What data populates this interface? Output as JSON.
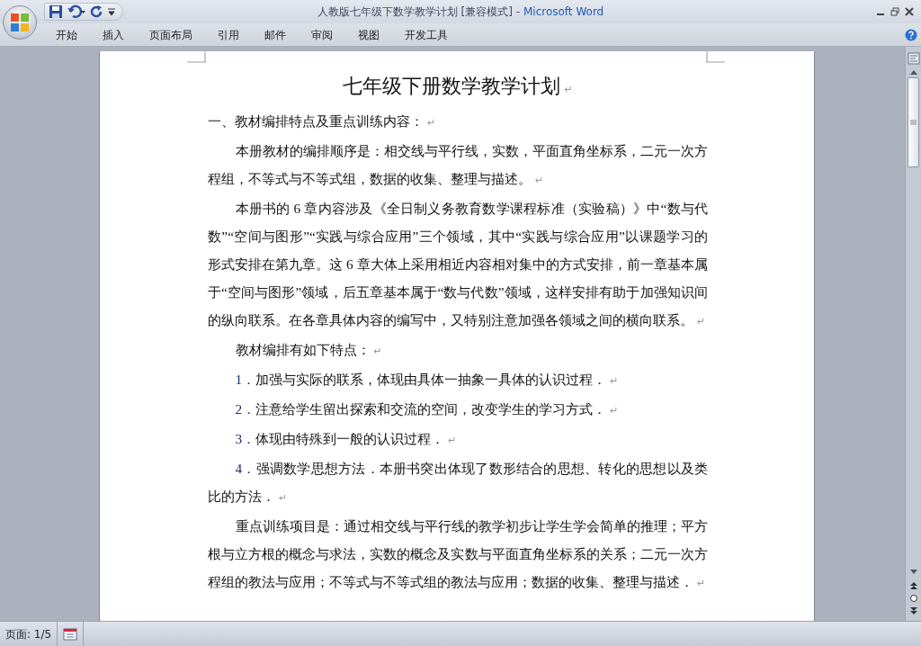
{
  "window": {
    "title": "人教版七年级下数学教学计划 [兼容模式]",
    "separator": "-",
    "app": "Microsoft Word"
  },
  "ribbon_tabs": [
    {
      "label": "开始"
    },
    {
      "label": "插入"
    },
    {
      "label": "页面布局"
    },
    {
      "label": "引用"
    },
    {
      "label": "邮件"
    },
    {
      "label": "审阅"
    },
    {
      "label": "视图"
    },
    {
      "label": "开发工具"
    }
  ],
  "document": {
    "title": "七年级下册数学教学计划",
    "title_mark": "↵",
    "paragraphs": [
      {
        "kind": "heading",
        "text": "一、教材编排特点及重点训练内容：",
        "mark": "↵"
      },
      {
        "kind": "body",
        "text": "本册教材的编排顺序是：相交线与平行线，实数，平面直角坐标系，二元一次方程组，不等式与不等式组，数据的收集、整理与描述。",
        "mark": "↵"
      },
      {
        "kind": "body",
        "text": "本册书的 6 章内容涉及《全日制义务教育数学课程标准（实验稿）》中“数与代数”“空间与图形”“实践与综合应用”三个领域，其中“实践与综合应用”以课题学习的形式安排在第九章。这 6 章大体上采用相近内容相对集中的方式安排，前一章基本属于“空间与图形”领域，后五章基本属于“数与代数”领域，这样安排有助于加强知识间的纵向联系。在各章具体内容的编写中，又特别注意加强各领域之间的横向联系。",
        "mark": "↵"
      },
      {
        "kind": "body",
        "text": "教材编排有如下特点：",
        "mark": "↵"
      },
      {
        "kind": "numbered",
        "number": "1．",
        "text": "加强与实际的联系，体现由具体一抽象一具体的认识过程．",
        "mark": "↵"
      },
      {
        "kind": "numbered",
        "number": "2．",
        "text": "注意给学生留出探索和交流的空间，改变学生的学习方式．",
        "mark": "↵"
      },
      {
        "kind": "numbered",
        "number": "3．",
        "text": "体现由特殊到一般的认识过程．",
        "mark": "↵"
      },
      {
        "kind": "numbered",
        "number": "4．",
        "text": "强调数学思想方法．本册书突出体现了数形结合的思想、转化的思想以及类比的方法．",
        "mark": "↵"
      },
      {
        "kind": "body",
        "text": "重点训练项目是：通过相交线与平行线的教学初步让学生学会简单的推理；平方根与立方根的概念与求法，实数的概念及实数与平面直角坐标系的关系；二元一次方程组的教法与应用；不等式与不等式组的教法与应用；数据的收集、整理与描述．",
        "mark": "↵"
      }
    ]
  },
  "status_bar": {
    "page": "页面: 1/5"
  }
}
